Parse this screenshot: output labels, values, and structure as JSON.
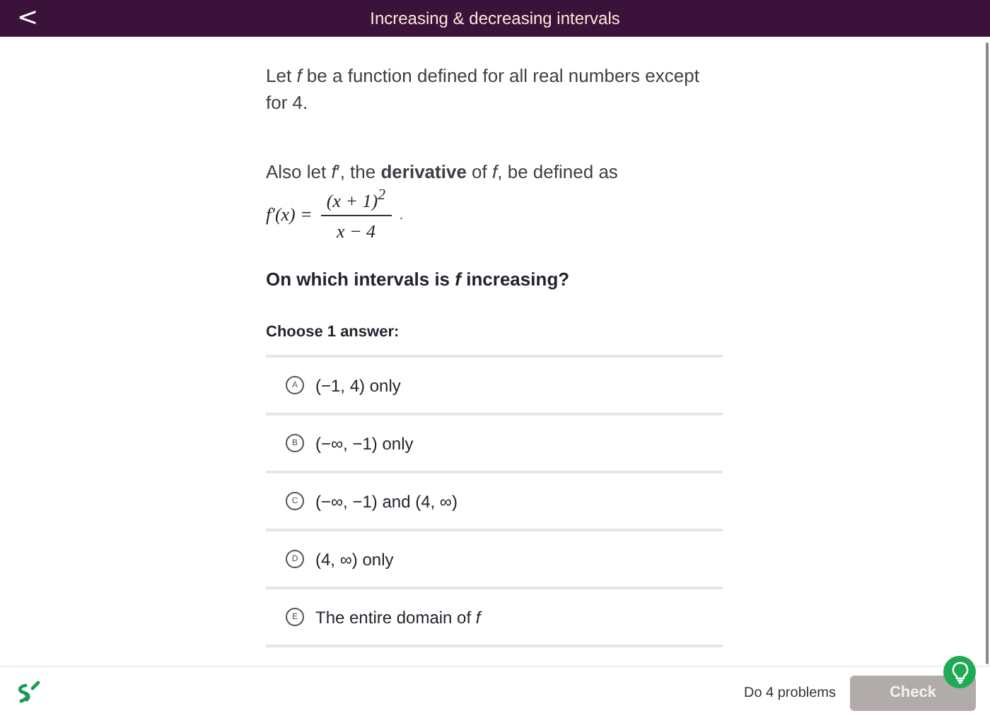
{
  "header": {
    "back": "<",
    "title": "Increasing & decreasing intervals"
  },
  "problem": {
    "intro": "Let *f* be a function defined for all real numbers except for 4.",
    "derivative_line": "Also let *f*′, the **derivative** of *f*, be defined as",
    "formula": {
      "lhs": "f′(x) =",
      "numerator": "(x + 1)$^{2}$",
      "denominator": "x − 4",
      "end": "."
    },
    "question": "On which intervals is *f* increasing?",
    "prompt": "Choose 1 answer:"
  },
  "choices": [
    {
      "letter": "A",
      "text": "(−1, 4) only",
      "selected": false
    },
    {
      "letter": "B",
      "text": "(−∞, −1) only",
      "selected": false
    },
    {
      "letter": "C",
      "text": "(−∞, −1) and (4, ∞)",
      "selected": false
    },
    {
      "letter": "D",
      "text": "(4, ∞) only",
      "selected": false
    },
    {
      "letter": "E",
      "text": "The entire domain of *f*",
      "selected": false
    }
  ],
  "footer": {
    "progress": "Do 4 problems",
    "check": {
      "label": "Check",
      "disabled": true
    }
  }
}
